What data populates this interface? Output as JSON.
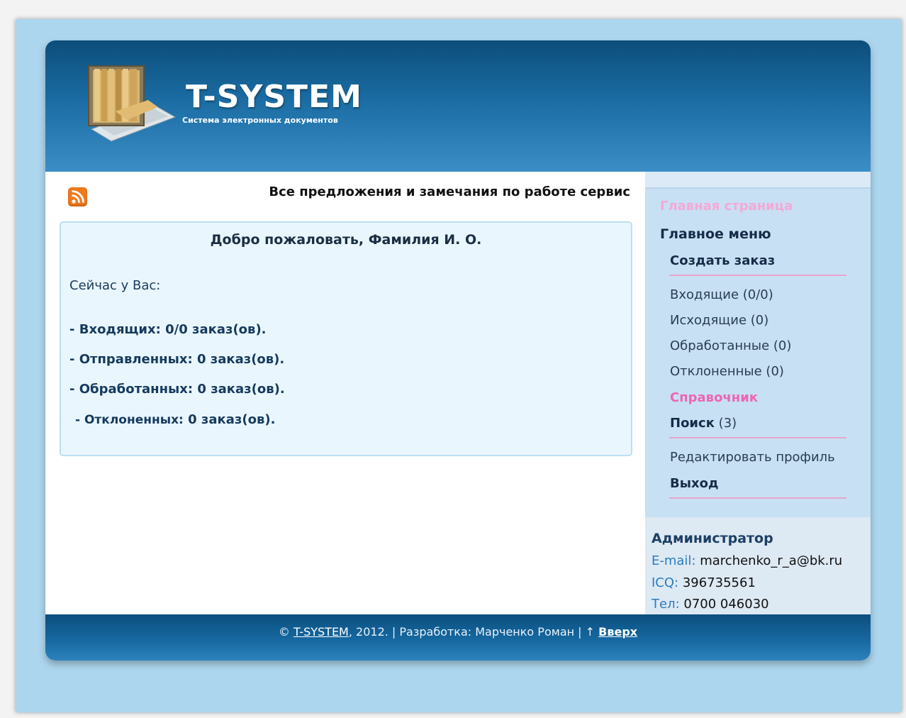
{
  "header": {
    "brand": "T-SYSTEM",
    "tagline": "Система электронных документов"
  },
  "announcement": {
    "text": "Все предложения и замечания по работе сервис"
  },
  "welcome": {
    "title": "Добро пожаловать, Фамилия И. О.",
    "now_label": "Сейчас у Вас:",
    "stats": [
      {
        "label": "- Входящих:",
        "value": "0/0 заказ(ов)."
      },
      {
        "label": "- Отправленных:",
        "value": "0 заказ(ов)."
      },
      {
        "label": "- Обработанных:",
        "value": "0 заказ(ов)."
      },
      {
        "label": "- Отклоненных:",
        "value": "0 заказ(ов)."
      }
    ]
  },
  "sidebar": {
    "home": "Главная страница",
    "main_menu": "Главное меню",
    "create_order": "Создать заказ",
    "incoming": "Входящие (0/0)",
    "outgoing": "Исходящие (0)",
    "processed": "Обработанные (0)",
    "rejected": "Отклоненные (0)",
    "directory": "Справочник",
    "search_label": "Поиск",
    "search_count": "(3)",
    "edit_profile": "Редактировать профиль",
    "logout": "Выход"
  },
  "admin": {
    "title": "Администратор",
    "email_label": "E-mail:",
    "email": "marchenko_r_a@bk.ru",
    "icq_label": "ICQ:",
    "icq": "396735561",
    "phone_label": "Тел:",
    "phone": "0700 046030"
  },
  "footer": {
    "copyright_symbol": "©",
    "brand_link": "T-SYSTEM",
    "year_text": ", 2012. | Разработка: Марченко Роман | ↑",
    "top_link": "Вверх"
  },
  "colors": {
    "header_dark": "#0c4e7a",
    "header_light": "#3b8ec6",
    "page_bg": "#acd6ee",
    "accent_pink": "#ee64b4",
    "navy": "#172c48"
  }
}
